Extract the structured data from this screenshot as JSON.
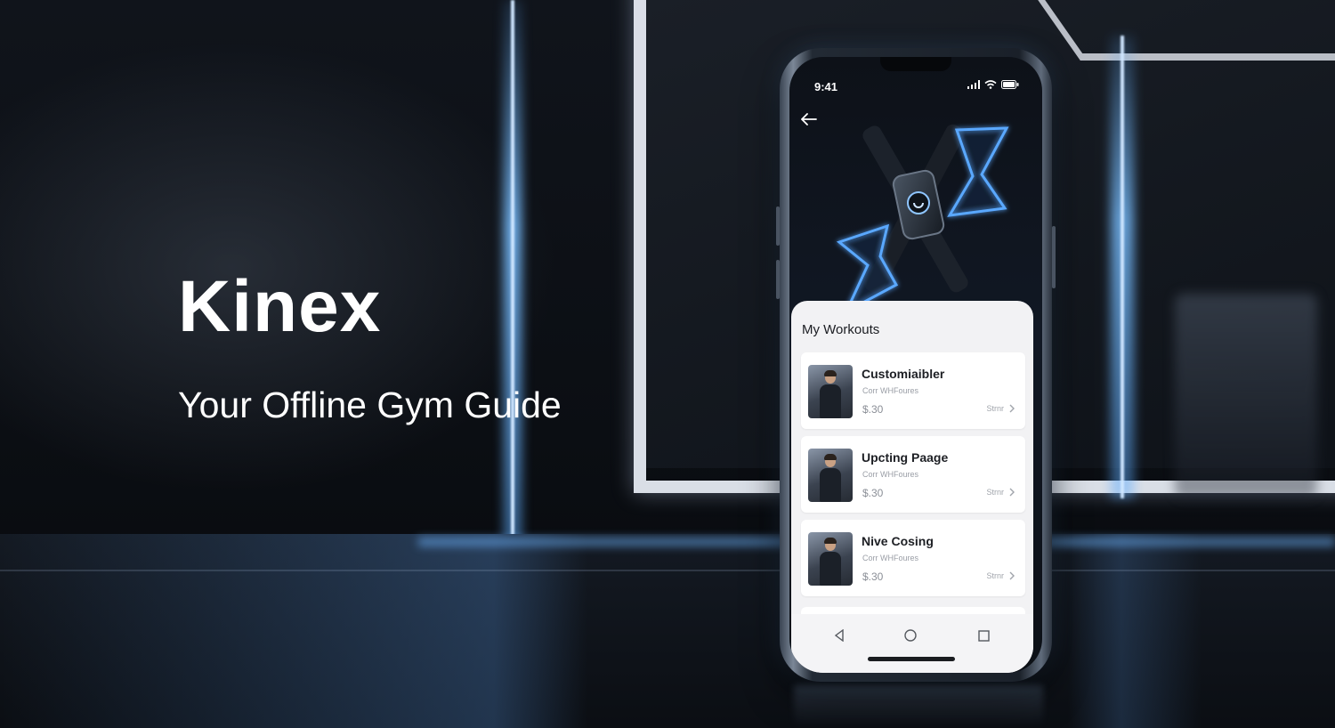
{
  "hero": {
    "title": "Kinex",
    "tagline": "Your Offline Gym Guide"
  },
  "phone": {
    "status_bar": {
      "time": "9:41",
      "icons": [
        "signal-icon",
        "wifi-icon",
        "battery-icon"
      ]
    },
    "back_icon": "back-arrow-icon",
    "sheet": {
      "title": "My Workouts",
      "workouts": [
        {
          "title": "Customiaibler",
          "subtitle": "Corr WHFoures",
          "price": "$.30",
          "more_label": "Strnr"
        },
        {
          "title": "Upcting Paage",
          "subtitle": "Corr WHFoures",
          "price": "$.30",
          "more_label": "Strnr"
        },
        {
          "title": "Nive Cosing",
          "subtitle": "Corr WHFoures",
          "price": "$.30",
          "more_label": "Strnr"
        }
      ]
    },
    "nav": [
      "back-triangle-icon",
      "home-circle-icon",
      "recents-square-icon"
    ]
  },
  "colors": {
    "accent_glow": "#5aa8ff",
    "sheet_bg": "#f2f2f4",
    "text_dark": "#1d1f24"
  }
}
